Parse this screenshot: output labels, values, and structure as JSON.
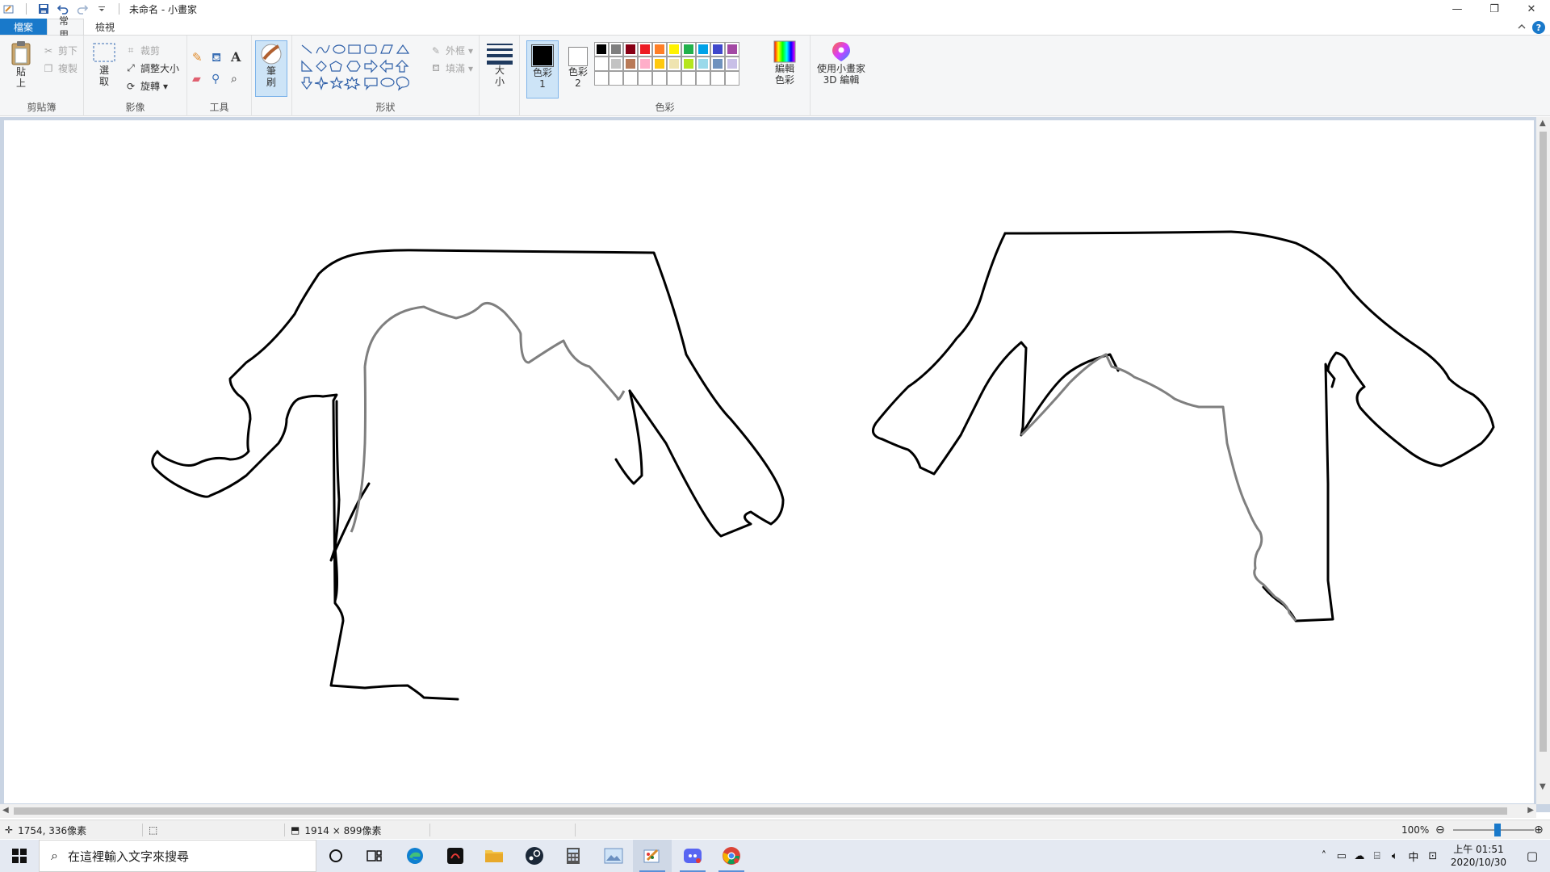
{
  "window": {
    "title": "未命名 - 小畫家",
    "minimize": "—",
    "restore": "❐",
    "close": "✕"
  },
  "ribbon_tabs": {
    "file": "檔案",
    "home": "常用",
    "view": "檢視"
  },
  "clipboard": {
    "paste": "貼上",
    "cut": "剪下",
    "copy": "複製",
    "label": "剪貼簿"
  },
  "image": {
    "select": "選取",
    "crop": "裁剪",
    "resize": "調整大小",
    "rotate": "旋轉",
    "label": "影像"
  },
  "tools": {
    "label": "工具"
  },
  "brushes": {
    "label": "筆刷"
  },
  "shapes": {
    "outline": "外框",
    "fill": "填滿",
    "label": "形狀"
  },
  "size": {
    "label": "大小"
  },
  "colors": {
    "color1": "色彩 1",
    "color2": "色彩 2",
    "edit": "編輯色彩",
    "label": "色彩",
    "color1_value": "#000000",
    "color2_value": "#ffffff",
    "palette_row1": [
      "#000000",
      "#7f7f7f",
      "#880015",
      "#ed1c24",
      "#ff7f27",
      "#fff200",
      "#22b14c",
      "#00a2e8",
      "#3f48cc",
      "#a349a4"
    ],
    "palette_row2": [
      "#ffffff",
      "#c3c3c3",
      "#b97a57",
      "#ffaec9",
      "#ffc90e",
      "#efe4b0",
      "#b5e61d",
      "#99d9ea",
      "#7092be",
      "#c8bfe7"
    ],
    "palette_row3": [
      "",
      "",
      "",
      "",
      "",
      "",
      "",
      "",
      "",
      ""
    ]
  },
  "paint3d": {
    "label": "使用小畫家 3D 編輯"
  },
  "status": {
    "cursor_pos": "1754, 336像素",
    "canvas_size": "1914 × 899像素",
    "zoom": "100%",
    "zoom_fraction": 0.55
  },
  "taskbar": {
    "search_placeholder": "在這裡輸入文字來搜尋",
    "tray_ime": "中",
    "clock_time": "上午 01:51",
    "clock_date": "2020/10/30"
  }
}
